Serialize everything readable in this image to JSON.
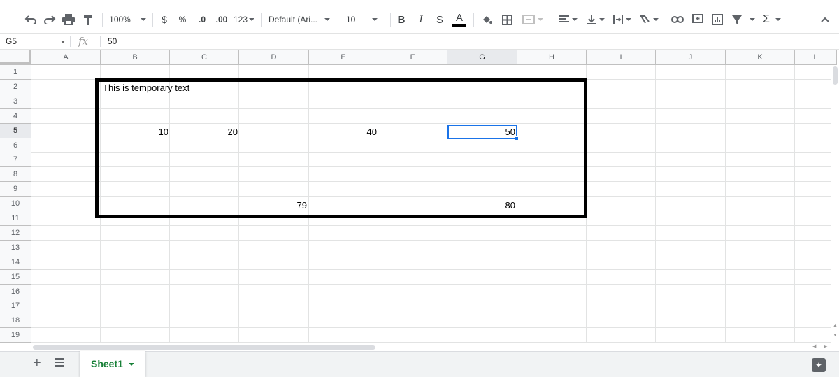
{
  "toolbar": {
    "zoom": "100%",
    "currency": "$",
    "percent": "%",
    "decrease_decimal": ".0",
    "increase_decimal": ".00",
    "more_formats": "123",
    "font_family": "Default (Ari...",
    "font_size": "10",
    "bold": "B",
    "italic": "I",
    "strikethrough": "S",
    "text_color": "A",
    "functions": "Σ"
  },
  "formula_bar": {
    "name_box": "G5",
    "fx": "fx",
    "value": "50"
  },
  "columns": [
    "A",
    "B",
    "C",
    "D",
    "E",
    "F",
    "G",
    "H",
    "I",
    "J",
    "K",
    "L"
  ],
  "rows": [
    "1",
    "2",
    "3",
    "4",
    "5",
    "6",
    "7",
    "8",
    "9",
    "10",
    "11",
    "12",
    "13",
    "14",
    "15",
    "16",
    "17",
    "18",
    "19"
  ],
  "cells": {
    "B2": "This is temporary text",
    "B5": "10",
    "C5": "20",
    "E5": "40",
    "G5": "50",
    "D10": "79",
    "G10": "80"
  },
  "selected_cell": "G5",
  "sheets": {
    "active": "Sheet1"
  },
  "colors": {
    "selection": "#1a73e8",
    "sheet_tab_text": "#188038",
    "header_bg": "#f8f9fa"
  }
}
